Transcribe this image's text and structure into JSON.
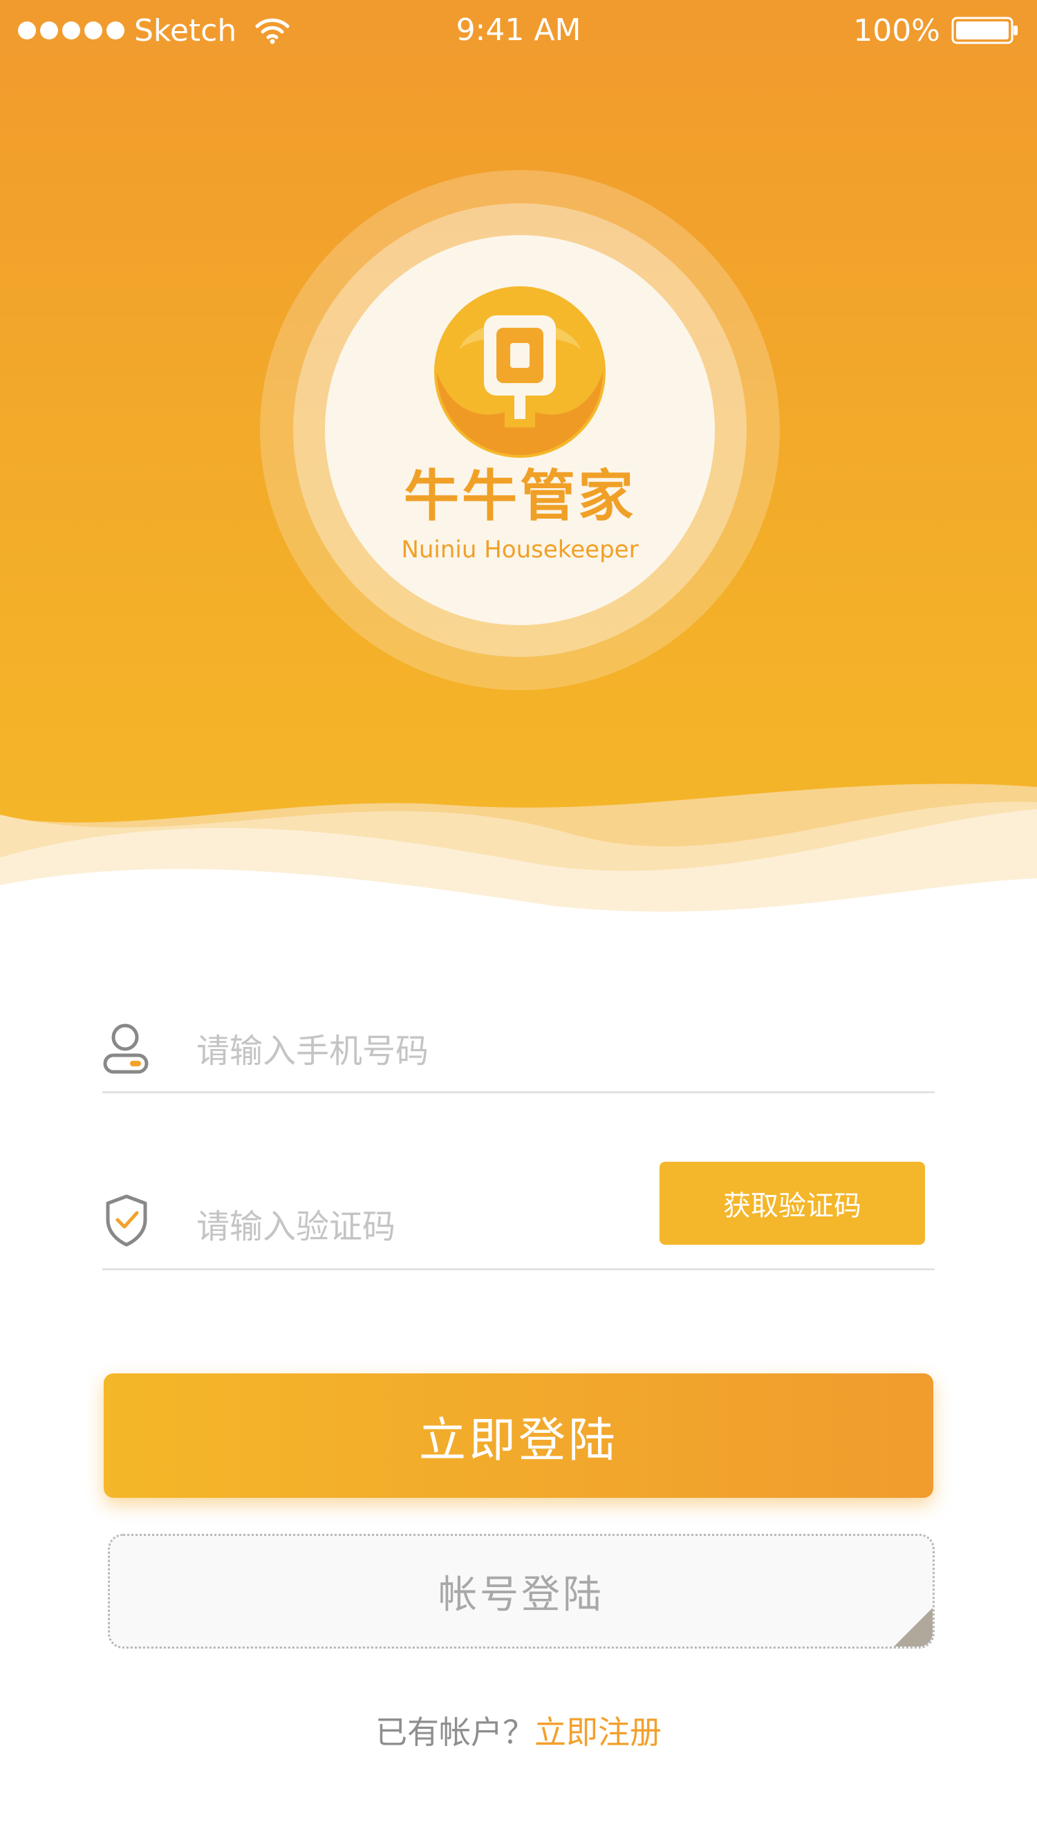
{
  "status_bar": {
    "carrier": "Sketch",
    "time": "9:41 AM",
    "battery": "100%"
  },
  "brand": {
    "name_cn": "牛牛管家",
    "name_en": "Nuiniu Housekeeper"
  },
  "form": {
    "phone_placeholder": "请输入手机号码",
    "code_placeholder": "请输入验证码",
    "get_code_label": "获取验证码"
  },
  "actions": {
    "login_label": "立即登陆",
    "account_login_label": "帐号登陆"
  },
  "register": {
    "prompt": "已有帐户？",
    "link": "立即注册"
  },
  "colors": {
    "primary": "#F4B62A",
    "primary_dark": "#F09C2E",
    "link": "#F2A02D"
  }
}
